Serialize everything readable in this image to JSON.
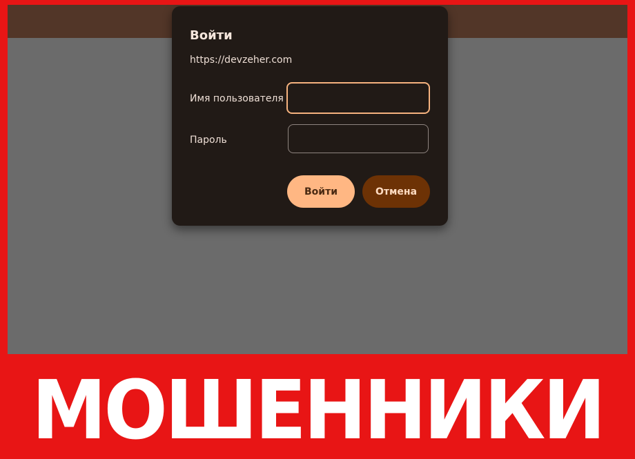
{
  "dialog": {
    "title": "Войти",
    "origin": "https://devzeher.com",
    "username_label": "Имя пользователя",
    "username_value": "",
    "password_label": "Пароль",
    "password_value": "",
    "login_button": "Войти",
    "cancel_button": "Отмена"
  },
  "banner": {
    "text": "МОШЕННИКИ"
  },
  "colors": {
    "frame": "#e81515",
    "dialog_bg": "#211a16",
    "primary_button": "#ffb783",
    "secondary_button": "#6d3205",
    "focus_border": "#f6b37f"
  }
}
